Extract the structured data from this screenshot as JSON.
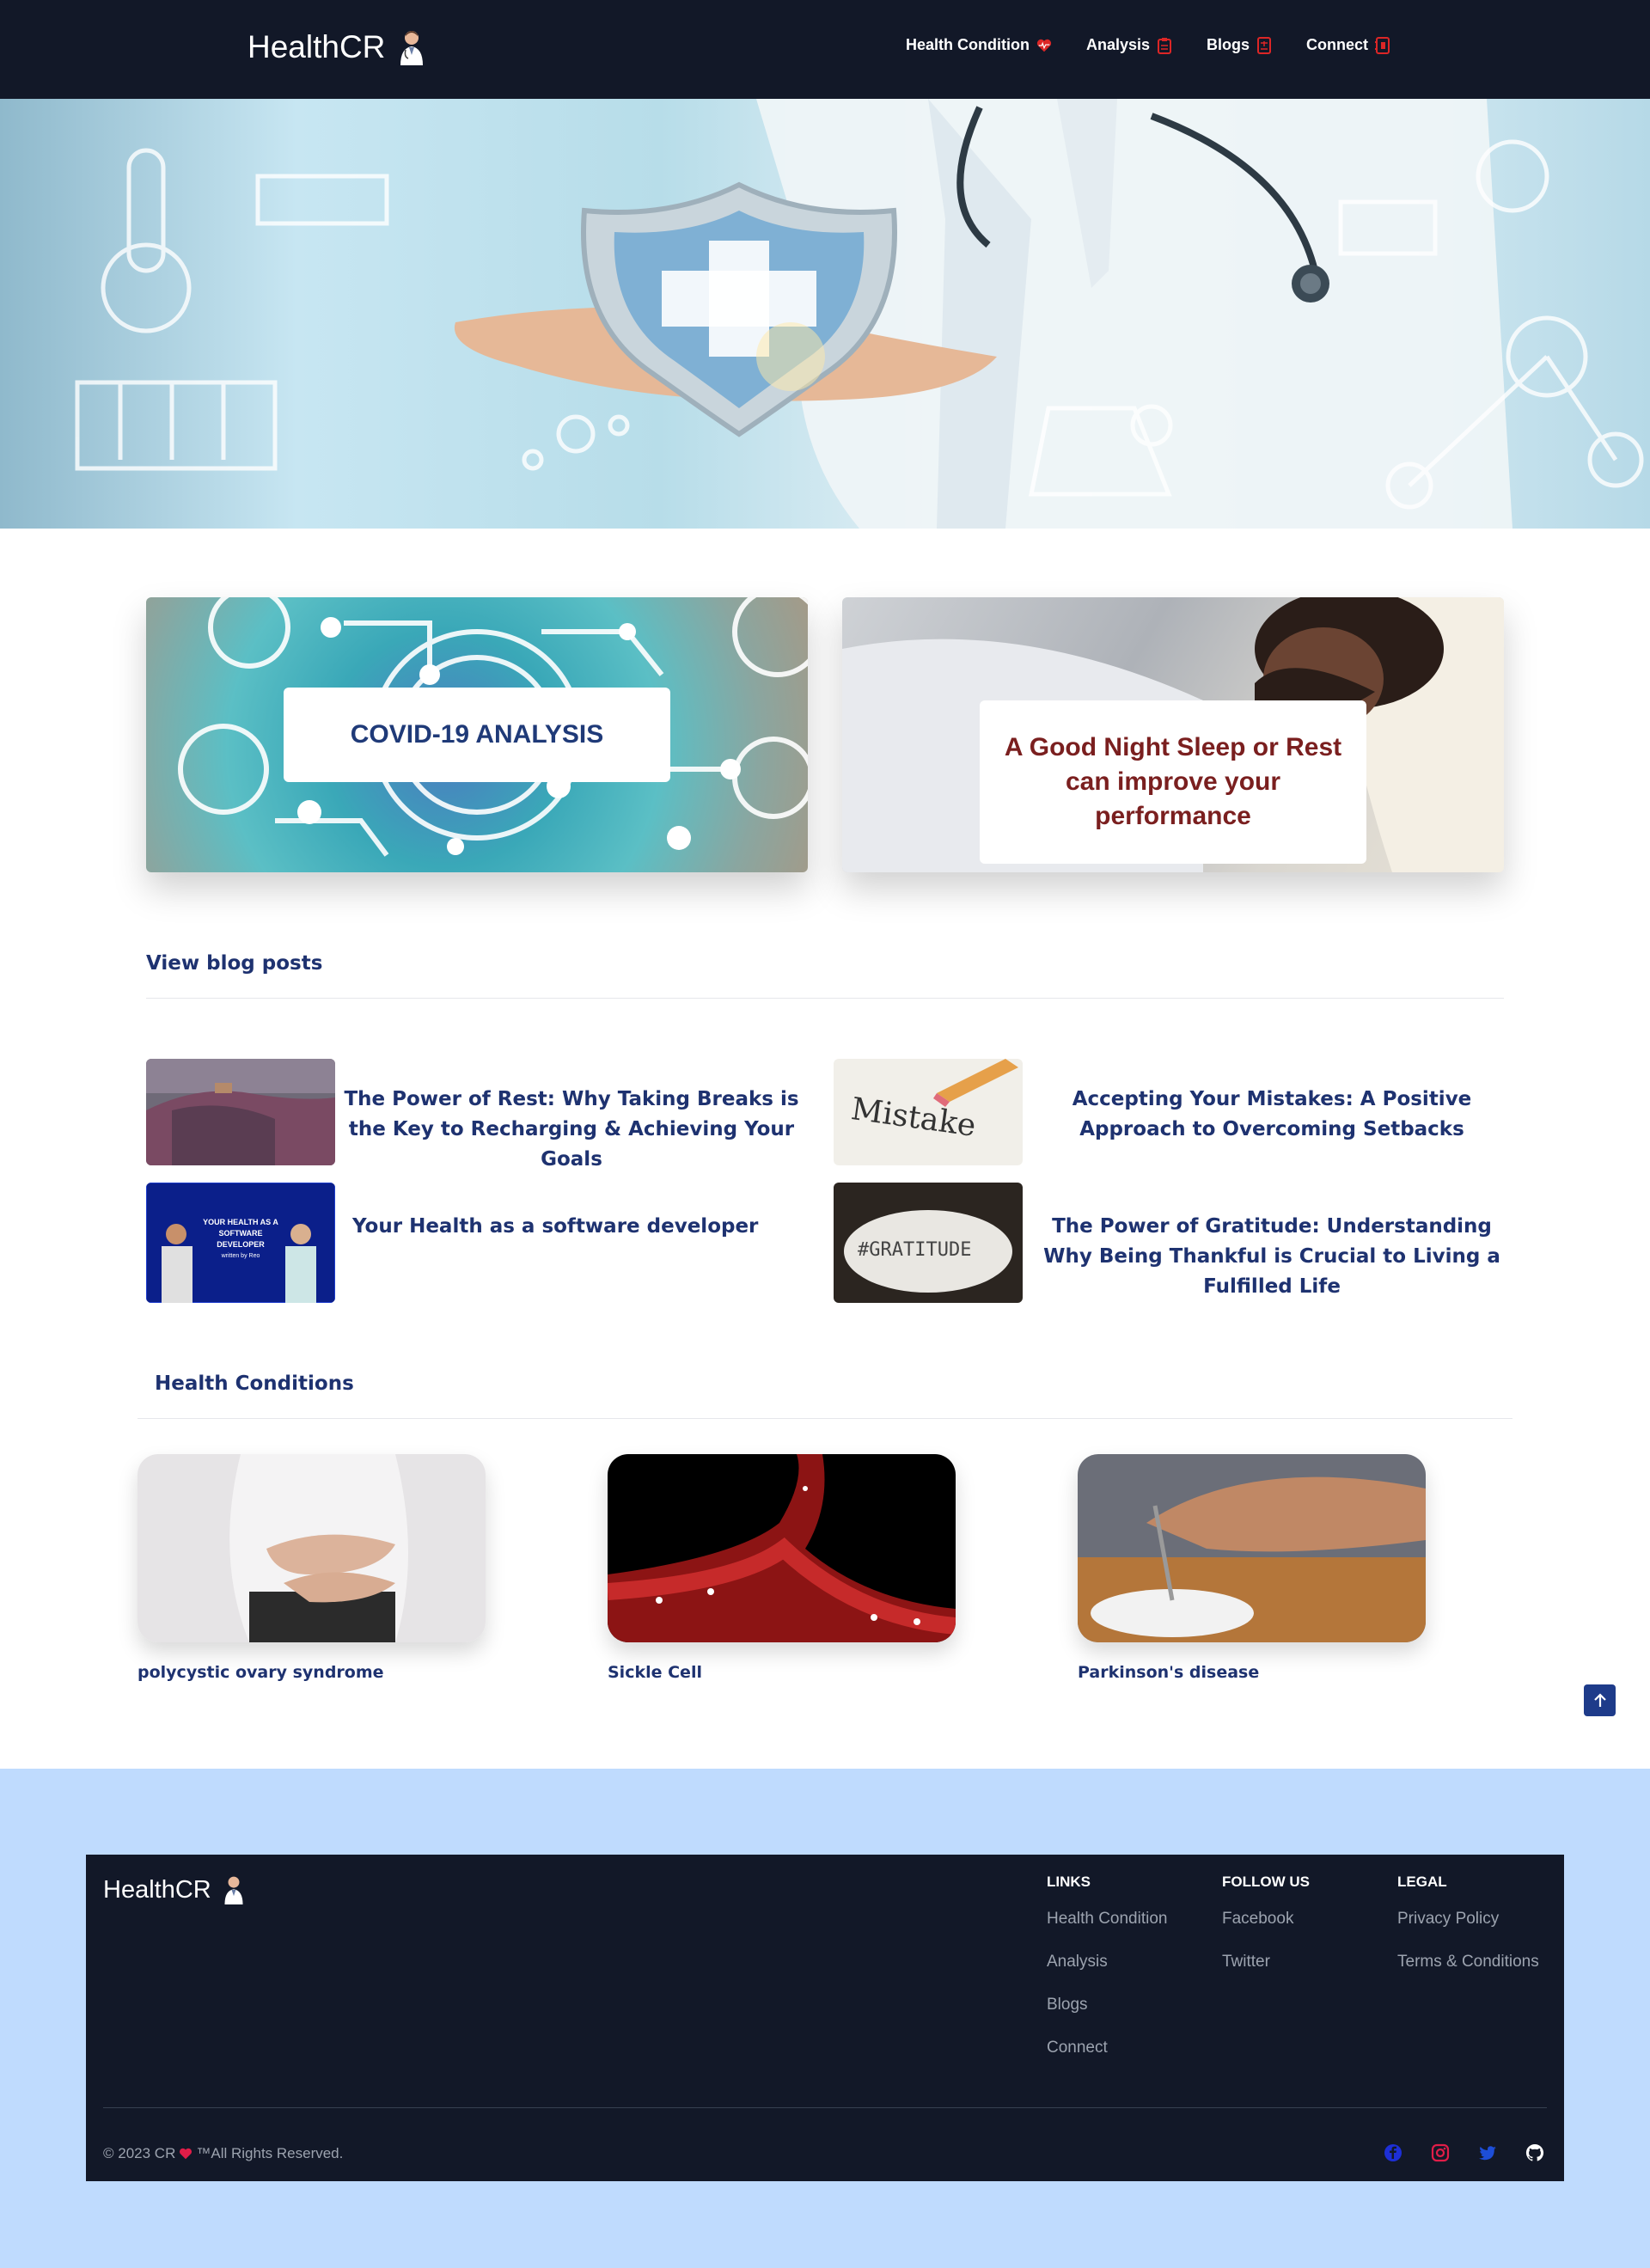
{
  "brand": {
    "name": "HealthCR",
    "icon": "doctor-icon"
  },
  "nav": {
    "items": [
      {
        "label": "Health Condition",
        "icon": "heart-pulse-icon"
      },
      {
        "label": "Analysis",
        "icon": "clipboard-icon"
      },
      {
        "label": "Blogs",
        "icon": "document-icon"
      },
      {
        "label": "Connect",
        "icon": "phone-book-icon"
      }
    ]
  },
  "features": [
    {
      "title": "COVID-19 ANALYSIS"
    },
    {
      "title": "A Good Night Sleep or Rest can improve your performance"
    }
  ],
  "blog": {
    "heading": "View blog posts",
    "posts": [
      {
        "title": "The Power of Rest: Why Taking Breaks is the Key to Recharging & Achieving Your Goals"
      },
      {
        "title": "Accepting Your Mistakes: A Positive Approach to Overcoming Setbacks",
        "thumb_text": "Mistake"
      },
      {
        "title": "Your Health as a software developer",
        "thumb_text_1": "YOUR HEALTH AS A",
        "thumb_text_2": "SOFTWARE DEVELOPER",
        "thumb_text_3": "written by Reo"
      },
      {
        "title": "The Power of Gratitude: Understanding Why Being Thankful is Crucial to Living a Fulfilled Life",
        "thumb_text": "#GRATITUDE"
      }
    ]
  },
  "conditions": {
    "heading": "Health Conditions",
    "items": [
      {
        "title": "polycystic ovary syndrome"
      },
      {
        "title": "Sickle Cell"
      },
      {
        "title": "Parkinson's disease"
      }
    ]
  },
  "footer": {
    "brand": "HealthCR",
    "links": {
      "heading": "LINKS",
      "items": [
        "Health Condition",
        "Analysis",
        "Blogs",
        "Connect"
      ]
    },
    "follow": {
      "heading": "FOLLOW US",
      "items": [
        "Facebook",
        "Twitter"
      ]
    },
    "legal": {
      "heading": "LEGAL",
      "items": [
        "Privacy Policy",
        "Terms & Conditions"
      ]
    },
    "copyright_prefix": "© 2023 CR",
    "copyright_suffix": "™All Rights Reserved.",
    "social": [
      "facebook-icon",
      "instagram-icon",
      "twitter-icon",
      "github-icon"
    ]
  },
  "colors": {
    "nav_bg": "#121828",
    "heading_blue": "#1e3270",
    "feature_red": "#7a1f1f",
    "footer_outer": "#bfdbfe",
    "accent_red": "#dc2626"
  }
}
